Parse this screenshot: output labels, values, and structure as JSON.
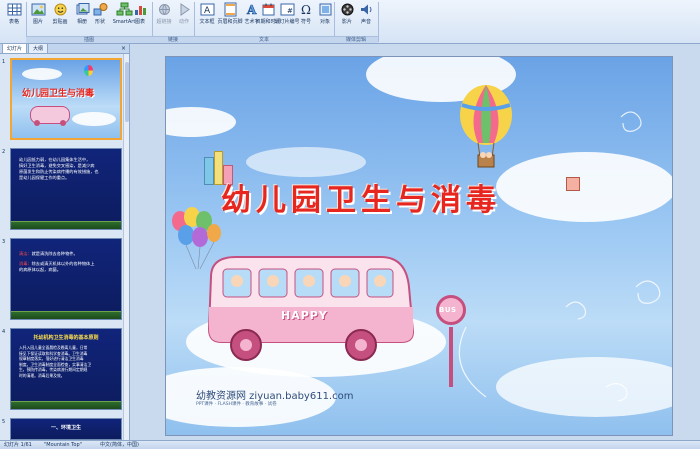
{
  "ribbon": {
    "buttons": [
      {
        "label": "表格",
        "icon": "table-icon",
        "enabled": true
      },
      {
        "label": "图片",
        "icon": "picture-icon",
        "enabled": true
      },
      {
        "label": "剪贴画",
        "icon": "clipart-icon",
        "enabled": true
      },
      {
        "label": "相册",
        "icon": "photo-album-icon",
        "enabled": true
      },
      {
        "label": "形状",
        "icon": "shapes-icon",
        "enabled": true
      },
      {
        "label": "SmartArt",
        "icon": "smartart-icon",
        "enabled": true
      },
      {
        "label": "图表",
        "icon": "chart-icon",
        "enabled": true
      },
      {
        "label": "超链接",
        "icon": "hyperlink-icon",
        "enabled": false
      },
      {
        "label": "动作",
        "icon": "action-icon",
        "enabled": false
      },
      {
        "label": "文本框",
        "icon": "textbox-icon",
        "enabled": true
      },
      {
        "label": "页眉和页脚",
        "icon": "header-footer-icon",
        "enabled": true
      },
      {
        "label": "艺术字",
        "icon": "wordart-icon",
        "enabled": true
      },
      {
        "label": "日期和时间",
        "icon": "datetime-icon",
        "enabled": true
      },
      {
        "label": "幻灯片编号",
        "icon": "slide-number-icon",
        "enabled": true
      },
      {
        "label": "符号",
        "icon": "symbol-icon",
        "enabled": true
      },
      {
        "label": "对象",
        "icon": "object-icon",
        "enabled": true
      },
      {
        "label": "影片",
        "icon": "movie-icon",
        "enabled": true
      },
      {
        "label": "声音",
        "icon": "sound-icon",
        "enabled": true
      }
    ],
    "groups": {
      "illustrations": "插图",
      "links": "链接",
      "text": "文本",
      "media": "媒体剪辑"
    }
  },
  "pane": {
    "tabs": [
      "幻灯片",
      "大纲"
    ],
    "close": "×"
  },
  "thumbnails": [
    {
      "number": "1",
      "title": "幼儿园卫生与消毒"
    },
    {
      "number": "2",
      "lines": [
        "幼儿园抵力弱，在幼儿园集体生活中，",
        "搞好卫生消毒，避免交叉感染，是减少病",
        "原菌发生和防止传染病传播的有效措施，也",
        "是幼儿园保健工作的重点。"
      ]
    },
    {
      "number": "3",
      "label_clean": "清洁：",
      "text_clean": "就是清洗除去各种物件。",
      "label_disinfect": "消毒：",
      "text_disinfect": "除去或清灭机体以外的各种物体上",
      "text_disinfect2": "的病原体以起，病菌。"
    },
    {
      "number": "4",
      "header": "托幼机构卫生消毒的基本原则",
      "lines": [
        "入托入园儿童全面晨检及晚离儿童，日常",
        "接见下保证读取和科学查消毒。卫生消毒",
        "规章制度落实，落好进行清洁卫生消毒",
        "制度。卫生消毒制度全面检查，实事清洁卫",
        "生。预防传消毒，传染病流行期间定期规",
        "时的清理。消毒后果及效。"
      ]
    },
    {
      "number": "5",
      "header": "一、环境卫生"
    }
  ],
  "slide": {
    "title": "幼儿园卫生与消毒",
    "bus_label": "HAPPY",
    "sign_label": "BUS",
    "watermark": "幼教资源网 ziyuan.baby611.com",
    "watermark_sub": "PPT课件 · FLASH课件 · 教育故事 · 试卷"
  },
  "status": {
    "slide_count": "幻灯片 1/61",
    "theme": "\"Mountain Top\"",
    "language": "中文(简体，中国)"
  },
  "colors": {
    "title_red": "#e6261f",
    "thumb_selected_border": "#f2a633",
    "dark_slide_bg": "#10247a"
  }
}
